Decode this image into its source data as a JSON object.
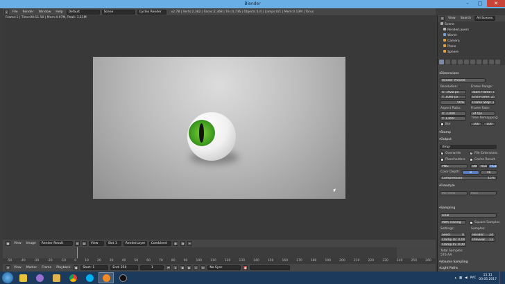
{
  "window": {
    "title": "Blender",
    "minimize": "–",
    "maximize": "□",
    "close": "✕"
  },
  "info_header": {
    "menus": [
      "File",
      "Render",
      "Window",
      "Help"
    ],
    "layout": "Default",
    "scene": "Scene",
    "engine": "Cycles Render",
    "stats": "v2.78 | Verts:2,382 | Faces:2,368 | Tris:4,736 | Objects:1/4 | Lamps:0/1 | Mem:0.13M | Torus"
  },
  "viewport": {
    "hud": "Frame:1 | Time:00:11.50 | Mem:4.97M, Peak: 1.11M"
  },
  "viewport_header": {
    "menus": [
      "View",
      "Image"
    ],
    "image_name": "Render Result",
    "view": "View",
    "slot": "Slot 1",
    "layer": "RenderLayer",
    "pass": "Combined"
  },
  "timeline": {
    "ticks": [
      "-50",
      "-40",
      "-30",
      "-20",
      "-10",
      "0",
      "10",
      "20",
      "30",
      "40",
      "50",
      "60",
      "70",
      "80",
      "90",
      "100",
      "110",
      "120",
      "130",
      "140",
      "150",
      "160",
      "170",
      "180",
      "190",
      "200",
      "210",
      "220",
      "230",
      "240",
      "250",
      "260"
    ],
    "menus": [
      "View",
      "Marker",
      "Frame",
      "Playback"
    ],
    "start_label": "Start:",
    "start": "1",
    "end_label": "End:",
    "end": "250",
    "current": "1",
    "sync": "No Sync"
  },
  "outliner": {
    "view": "View",
    "search": "Search",
    "filter": "All Scenes",
    "items": [
      "Scene",
      "RenderLayers",
      "World",
      "Camera",
      "Plane",
      "Sphere"
    ]
  },
  "properties": {
    "dimensions": {
      "section": "Dimensions",
      "presets": "Render Presets",
      "resolution_label": "Resolution:",
      "res_x": "X:   1920 px",
      "res_y": "Y:   1080 px",
      "res_pct": "50%",
      "frame_range_label": "Frame Range:",
      "start_frame": "Start Frame:   1",
      "end_frame": "End Frame: 250",
      "frame_step": "Frame Step:  1",
      "aspect_label": "Aspect Ratio:",
      "aspect_x": "X:   1.000",
      "aspect_y": "Y:   1.000",
      "frame_rate_label": "Frame Rate:",
      "frame_rate": "24 fps",
      "time_remap_label": "Time Remapping:",
      "remap_old": "100",
      "remap_new": "100",
      "border": "Bor"
    },
    "stamp_section": "Stamp",
    "output": {
      "section": "Output",
      "path": "/tmp/",
      "overwrite": "Overwrite",
      "file_extensions": "File Extensions",
      "placeholders": "Placeholders",
      "cache_result": "Cache Result",
      "format": "PNG",
      "bw": "BW",
      "rgb": "RGB",
      "rgba": "RGBA",
      "color_depth_label": "Color Depth:",
      "depth_8": "8",
      "depth_16": "16",
      "compression": "Compression:",
      "compression_pct": "15%"
    },
    "freestyle_section": "Freestyle",
    "freestyle_opts": [
      "Per View",
      "Pass"
    ],
    "sampling": {
      "section": "Sampling",
      "preset": "Final",
      "method": "Path Tracing",
      "square": "Square Samples",
      "settings_label": "Settings:",
      "samples_label": "Samples:",
      "seed": "Seed:",
      "seed_val": "0",
      "clamp_direct": "Clamp Di: 0.00",
      "clamp_indirect": "Clamp In: 0.00",
      "render": "Render:",
      "render_val": "24",
      "preview": "Preview:",
      "preview_val": "12",
      "total_label": "Total Samples:",
      "total_val": "576 AA"
    },
    "volume_section": "Volume Sampling",
    "light_section": "Light Paths"
  },
  "taskbar": {
    "lang": "РУС",
    "time": "15:11",
    "date": "03.05.2017"
  },
  "colors": {
    "accent": "#5680c2",
    "playhead": "#5fc65f",
    "titlebar": "#6aaee6",
    "iris": "#3f9d1f"
  }
}
